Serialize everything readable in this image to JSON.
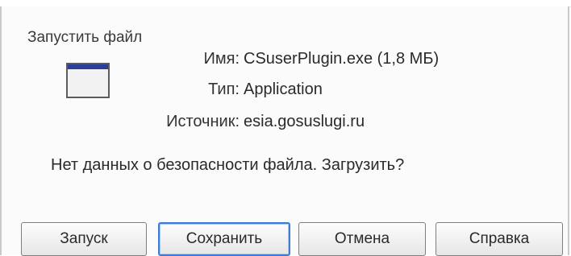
{
  "dialog": {
    "group_title": "Запустить файл",
    "name_label": "Имя:",
    "name_value": "CSuserPlugin.exe (1,8 МБ)",
    "type_label": "Тип:",
    "type_value": "Application",
    "source_label": "Источник:",
    "source_value": "esia.gosuslugi.ru",
    "question": "Нет данных о безопасности файла. Загрузить?",
    "buttons": {
      "run": "Запуск",
      "save": "Сохранить",
      "cancel": "Отмена",
      "help": "Справка"
    },
    "default_button": "save",
    "icon": "application-window-icon"
  }
}
